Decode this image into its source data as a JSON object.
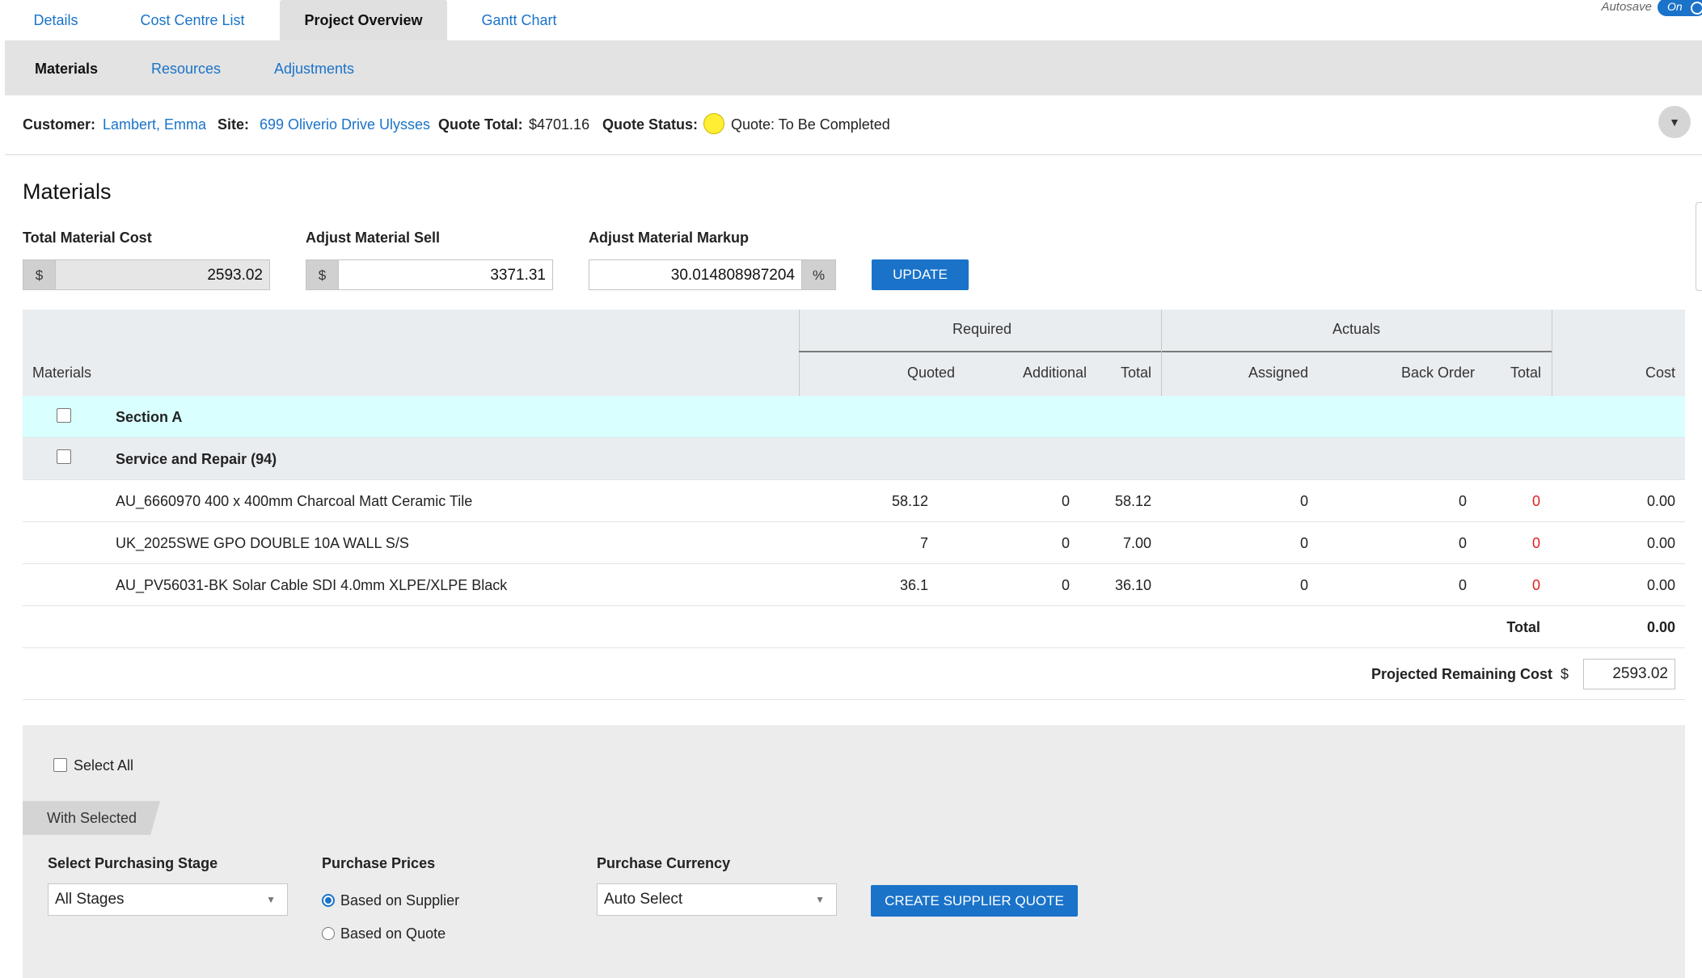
{
  "top_tabs": [
    "Details",
    "Cost Centre List",
    "Project Overview",
    "Gantt Chart"
  ],
  "autosave": {
    "label": "Autosave",
    "state": "On"
  },
  "sub_tabs": [
    "Materials",
    "Resources",
    "Adjustments"
  ],
  "info": {
    "customer_label": "Customer:",
    "customer": "Lambert, Emma",
    "site_label": "Site:",
    "site": "699 Oliverio Drive Ulysses",
    "quote_total_label": "Quote Total:",
    "quote_total": "$4701.16",
    "quote_status_label": "Quote Status:",
    "quote_status": "Quote: To Be Completed",
    "status_color": "#ffee33",
    "collapse_icon": "▼"
  },
  "materials": {
    "title": "Materials",
    "total_cost_label": "Total Material Cost",
    "total_cost": "2593.02",
    "sell_label": "Adjust Material Sell",
    "sell": "3371.31",
    "markup_label": "Adjust Material Markup",
    "markup": "30.014808987204",
    "currency_symbol": "$",
    "percent_symbol": "%",
    "update_button": "UPDATE"
  },
  "table": {
    "group_required": "Required",
    "group_actuals": "Actuals",
    "col_materials": "Materials",
    "col_quoted": "Quoted",
    "col_additional": "Additional",
    "col_total": "Total",
    "col_assigned": "Assigned",
    "col_back_order": "Back Order",
    "col_actual_total": "Total",
    "col_cost": "Cost",
    "section": "Section A",
    "group": "Service and Repair (94)",
    "rows": [
      {
        "name": "AU_6660970 400 x 400mm Charcoal Matt Ceramic Tile",
        "quoted": "58.12",
        "additional": "0",
        "total": "58.12",
        "assigned": "0",
        "back_order": "0",
        "actual_total": "0",
        "cost": "0.00"
      },
      {
        "name": "UK_2025SWE GPO DOUBLE 10A WALL S/S",
        "quoted": "7",
        "additional": "0",
        "total": "7.00",
        "assigned": "0",
        "back_order": "0",
        "actual_total": "0",
        "cost": "0.00"
      },
      {
        "name": "AU_PV56031-BK Solar Cable SDI 4.0mm XLPE/XLPE Black",
        "quoted": "36.1",
        "additional": "0",
        "total": "36.10",
        "assigned": "0",
        "back_order": "0",
        "actual_total": "0",
        "cost": "0.00"
      }
    ],
    "footer_total_label": "Total",
    "footer_total": "0.00",
    "projected_label": "Projected Remaining Cost",
    "projected_currency": "$",
    "projected_value": "2593.02"
  },
  "bottom": {
    "select_all": "Select All",
    "with_selected": "With Selected",
    "stage_label": "Select Purchasing Stage",
    "stage_value": "All Stages",
    "prices_label": "Purchase Prices",
    "price_option_supplier": "Based on Supplier",
    "price_option_quote": "Based on Quote",
    "currency_label": "Purchase Currency",
    "currency_value": "Auto Select",
    "create_button": "CREATE SUPPLIER QUOTE"
  }
}
